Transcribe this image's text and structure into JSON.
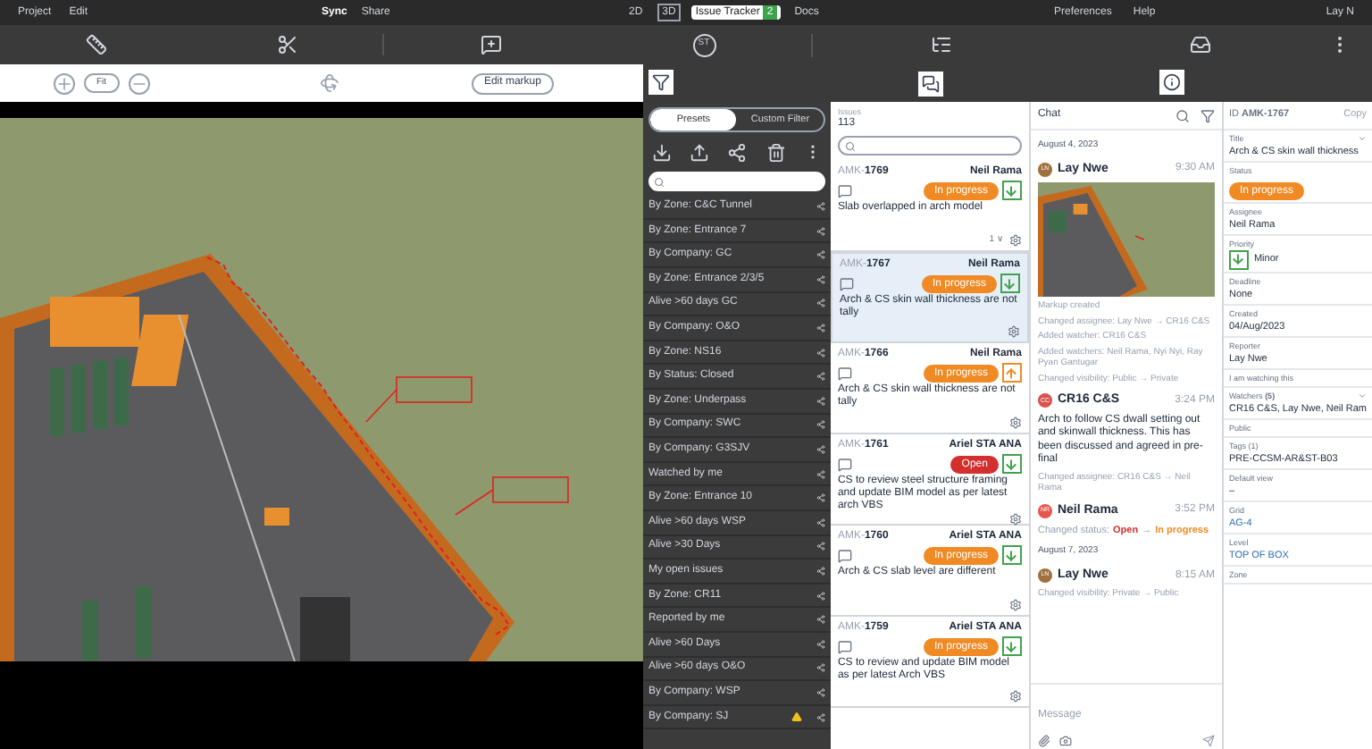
{
  "menu": {
    "left": [
      "Project",
      "Edit"
    ],
    "center": [
      {
        "label": "Sync",
        "selected": true
      },
      {
        "label": "Share",
        "selected": false
      }
    ],
    "views": [
      {
        "label": "2D",
        "kind": "plain",
        "selected": false
      },
      {
        "label": "3D",
        "kind": "boxed",
        "selected": false
      },
      {
        "label": "Issue Tracker",
        "kind": "plain",
        "selected": true,
        "badge": "2"
      },
      {
        "label": "Docs",
        "kind": "plain",
        "selected": false
      }
    ],
    "right": [
      "Preferences",
      "Help"
    ],
    "user": "Lay N"
  },
  "toolbar": {
    "user_initials": "ST"
  },
  "viewer": {
    "fit": "Fit",
    "edit": "Edit markup"
  },
  "filters": {
    "segments": [
      {
        "label": "Presets",
        "selected": true
      },
      {
        "label": "Custom Filter",
        "selected": false
      }
    ],
    "presets": [
      {
        "label": "By Zone: C&C Tunnel",
        "warning": false
      },
      {
        "label": "By Zone: Entrance 7",
        "warning": false
      },
      {
        "label": "By Company: GC",
        "warning": false
      },
      {
        "label": "By Zone: Entrance 2/3/5",
        "warning": false
      },
      {
        "label": "Alive >60 days GC",
        "warning": false
      },
      {
        "label": "By Company: O&O",
        "warning": false
      },
      {
        "label": "By Zone: NS16",
        "warning": false
      },
      {
        "label": "By Status: Closed",
        "warning": false
      },
      {
        "label": "By Zone: Underpass",
        "warning": false
      },
      {
        "label": "By Company: SWC",
        "warning": false
      },
      {
        "label": "By Company: G3SJV",
        "warning": false
      },
      {
        "label": "Watched by me",
        "warning": false
      },
      {
        "label": "By Zone: Entrance 10",
        "warning": false
      },
      {
        "label": "Alive >60 days WSP",
        "warning": false
      },
      {
        "label": "Alive >30 Days",
        "warning": false
      },
      {
        "label": "My open issues",
        "warning": false
      },
      {
        "label": "By Zone: CR11",
        "warning": false
      },
      {
        "label": "Reported by me",
        "warning": false
      },
      {
        "label": "Alive >60 Days",
        "warning": false
      },
      {
        "label": "Alive >60 days O&O",
        "warning": false
      },
      {
        "label": "By Company: WSP",
        "warning": false
      },
      {
        "label": "By Company: SJ",
        "warning": true
      }
    ]
  },
  "issues": {
    "label": "Issues",
    "count": "113",
    "items": [
      {
        "id": "AMK-**1769**",
        "assignee": "Neil Rama",
        "status": {
          "label": "In progress",
          "color": "#f08a24"
        },
        "priority": {
          "kind": "down",
          "color": "#3fa34d"
        },
        "title": "Slab overlapped in arch model",
        "replies": "1 ∨",
        "selected": false
      },
      {
        "id": "AMK-**1767**",
        "assignee": "Neil Rama",
        "status": {
          "label": "In progress",
          "color": "#f08a24"
        },
        "priority": {
          "kind": "down",
          "color": "#3fa34d"
        },
        "title": "Arch & CS skin wall thickness are not tally",
        "selected": true
      },
      {
        "id": "AMK-**1766**",
        "assignee": "Neil Rama",
        "status": {
          "label": "In progress",
          "color": "#f08a24"
        },
        "priority": {
          "kind": "up",
          "color": "#f08a24"
        },
        "title": "Arch & CS skin wall thickness are not tally",
        "selected": false
      },
      {
        "id": "AMK-**1761**",
        "assignee": "Ariel STA ANA",
        "status": {
          "label": "Open",
          "color": "#d32f2f"
        },
        "priority": {
          "kind": "down",
          "color": "#3fa34d"
        },
        "title": "CS to review steel structure framing and update BIM model as per latest arch VBS",
        "selected": false
      },
      {
        "id": "AMK-**1760**",
        "assignee": "Ariel STA ANA",
        "status": {
          "label": "In progress",
          "color": "#f08a24"
        },
        "priority": {
          "kind": "down",
          "color": "#3fa34d"
        },
        "title": "Arch & CS slab level are different",
        "selected": false
      },
      {
        "id": "AMK-**1759**",
        "assignee": "Ariel STA ANA",
        "status": {
          "label": "In progress",
          "color": "#f08a24"
        },
        "priority": {
          "kind": "down",
          "color": "#3fa34d"
        },
        "title": "CS to review and update BIM model as per latest Arch VBS",
        "selected": false
      }
    ]
  },
  "chat": {
    "title": "Chat",
    "placeholder": "Message",
    "entries": [
      {
        "kind": "date",
        "text": "August 4, 2023"
      },
      {
        "kind": "author",
        "initials": "LN",
        "name": "Lay Nwe",
        "time": "9:30 AM",
        "color": "#a0703f"
      },
      {
        "kind": "image"
      },
      {
        "kind": "event",
        "text": "Markup created"
      },
      {
        "kind": "event",
        "text": "Changed assignee: Lay Nwe → CR16 C&S"
      },
      {
        "kind": "event",
        "text": "Added watcher: CR16 C&S"
      },
      {
        "kind": "event",
        "text": "Added watchers: Neil Rama, Nyi Nyi, Ray Pyan Gantugar"
      },
      {
        "kind": "event",
        "text": "Changed visibility: Public → Private"
      },
      {
        "kind": "author",
        "initials": "CC",
        "name": "CR16 C&S",
        "time": "3:24 PM",
        "color": "#d9534f"
      },
      {
        "kind": "message",
        "text": "Arch to follow CS dwall setting out and skinwall thickness. This has been discussed and agreed in pre-final"
      },
      {
        "kind": "event",
        "text": "Changed assignee: CR16 C&S → Neil Rama"
      },
      {
        "kind": "author",
        "initials": "NR",
        "name": "Neil Rama",
        "time": "3:52 PM",
        "color": "#e8574e"
      },
      {
        "kind": "status",
        "label": "Changed status:",
        "from": {
          "text": "Open",
          "color": "#d32f2f"
        },
        "arrow": "→",
        "to": {
          "text": "In progress",
          "color": "#f08a24"
        }
      },
      {
        "kind": "date",
        "text": "August 7, 2023"
      },
      {
        "kind": "author",
        "initials": "LN",
        "name": "Lay Nwe",
        "time": "8:15 AM",
        "color": "#a0703f"
      },
      {
        "kind": "event",
        "text": "Changed visibility: Private → Public"
      }
    ]
  },
  "details": {
    "id": "ID **AMK-1767**",
    "copy": "Copy",
    "fields": [
      {
        "kind": "title",
        "label": "Title",
        "value": "Arch & CS skin wall thickness"
      },
      {
        "kind": "status",
        "label": "Status",
        "value": "In progress",
        "color": "#f08a24"
      },
      {
        "kind": "text",
        "label": "Assignee",
        "value": "Neil Rama"
      },
      {
        "kind": "priority",
        "label": "Priority",
        "value": "Minor",
        "priority": {
          "kind": "down",
          "color": "#3fa34d"
        }
      },
      {
        "kind": "text",
        "label": "Deadline",
        "value": "None"
      },
      {
        "kind": "text",
        "label": "Created",
        "value": "04/Aug/2023"
      },
      {
        "kind": "text",
        "label": "Reporter",
        "value": "Lay Nwe"
      },
      {
        "kind": "label",
        "label": "I am watching this"
      },
      {
        "kind": "title",
        "label": "Watchers **(5)**",
        "value": "CR16 C&S, Lay Nwe, Neil Ram"
      },
      {
        "kind": "label",
        "label": "Public"
      },
      {
        "kind": "text",
        "label": "Tags (1)",
        "value": "PRE-CCSM-AR&ST-B03"
      },
      {
        "kind": "text",
        "label": "Default view",
        "value": "–"
      },
      {
        "kind": "link",
        "label": "Grid",
        "value": "AG-4"
      },
      {
        "kind": "link",
        "label": "Level",
        "value": "TOP OF BOX"
      },
      {
        "kind": "label",
        "label": "Zone"
      }
    ]
  }
}
